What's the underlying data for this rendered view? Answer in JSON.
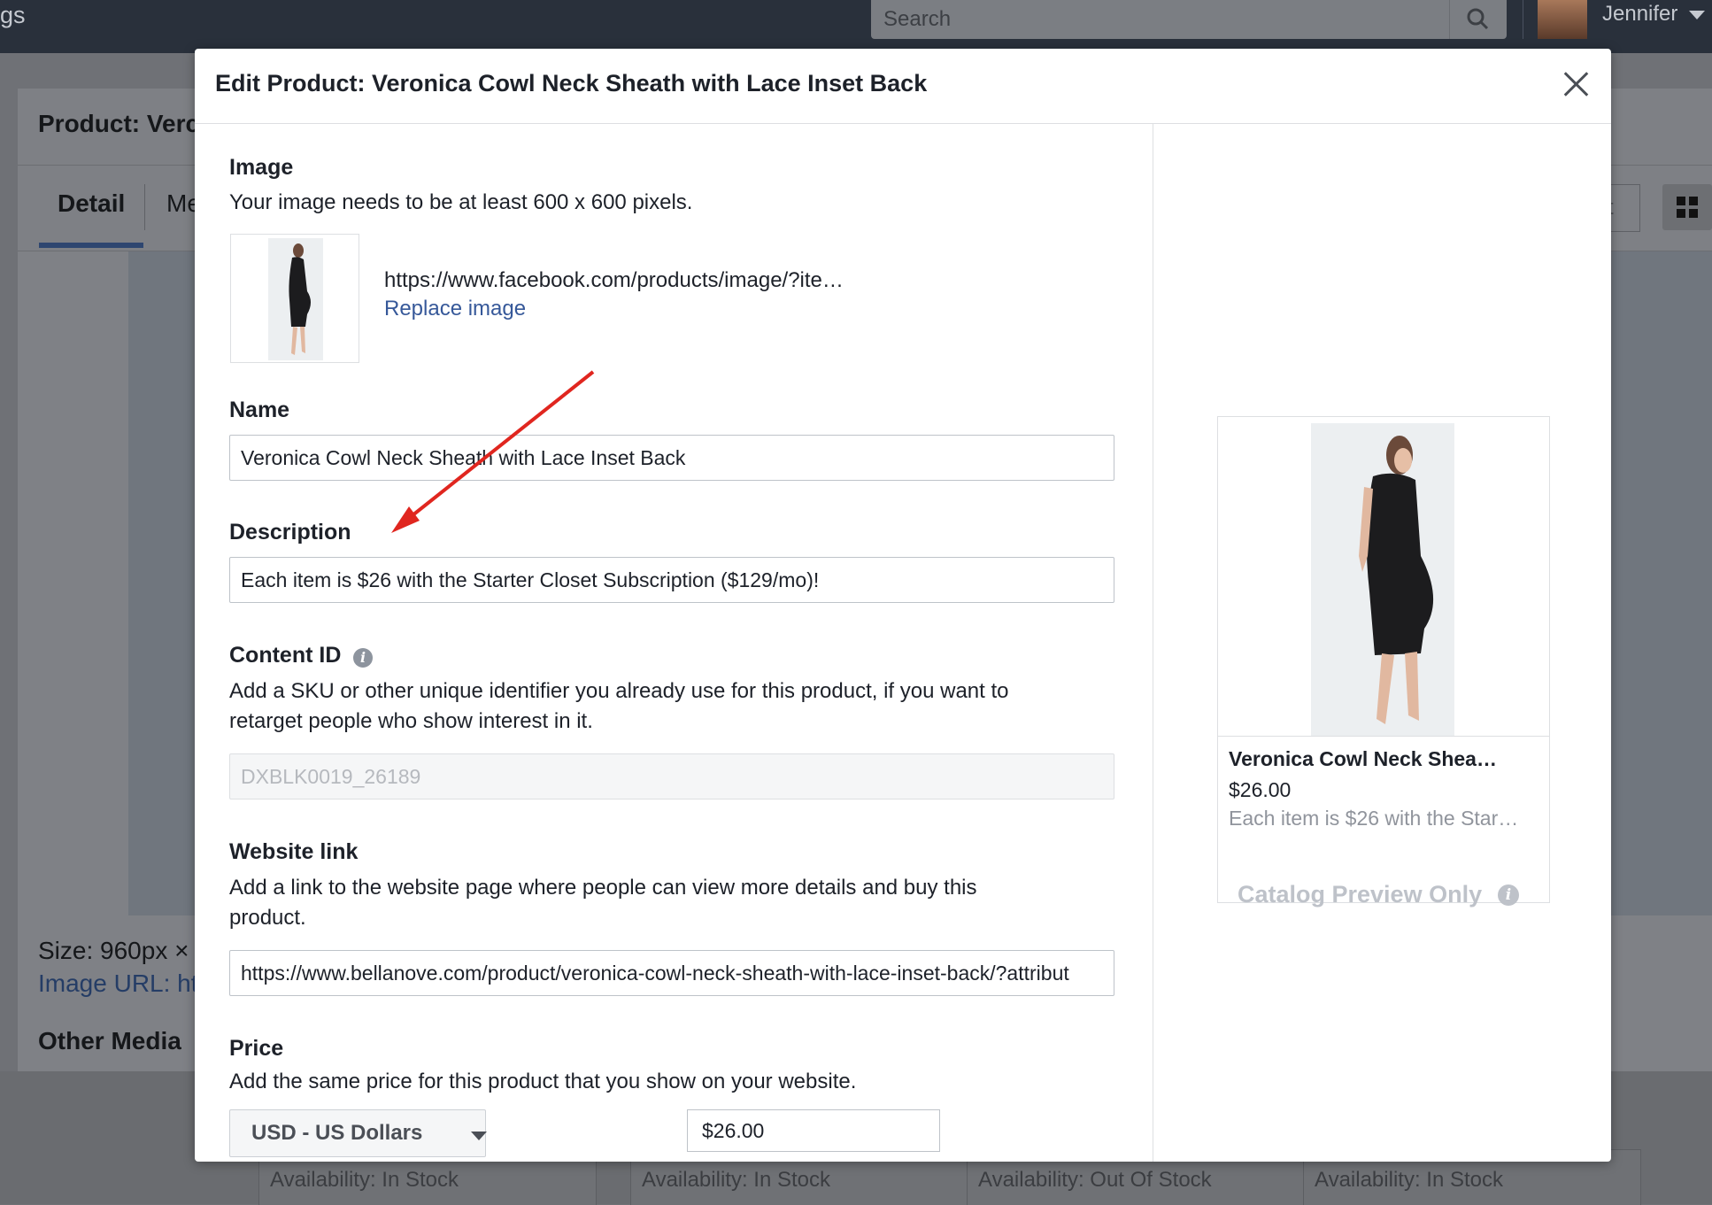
{
  "topbar": {
    "brand_fragment": "gs",
    "search_placeholder": "Search",
    "user_name": "Jennifer"
  },
  "background": {
    "product_title": "Product: Verc",
    "tabs": [
      "Detail",
      "Me"
    ],
    "size_text": "Size: 960px ×",
    "image_url_text": "Image URL: ht",
    "other_media": "Other Media",
    "right_button_fragment": "t",
    "availability": [
      "Availability: In Stock",
      "Availability: In Stock",
      "Availability: Out Of Stock",
      "Availability: In Stock"
    ]
  },
  "modal": {
    "title": "Edit Product: Veronica Cowl Neck Sheath with Lace Inset Back",
    "image": {
      "label": "Image",
      "help": "Your image needs to be at least 600 x 600 pixels.",
      "url": "https://www.facebook.com/products/image/?ite…",
      "replace_link": "Replace image"
    },
    "name": {
      "label": "Name",
      "value": "Veronica Cowl Neck Sheath with Lace Inset Back"
    },
    "description": {
      "label": "Description",
      "value": "Each item is $26 with the Starter Closet Subscription ($129/mo)!"
    },
    "content_id": {
      "label": "Content ID",
      "help_line1": "Add a SKU or other unique identifier you already use for this product, if you want to",
      "help_line2": "retarget people who show interest in it.",
      "value": "DXBLK0019_26189"
    },
    "website_link": {
      "label": "Website link",
      "help_line1": "Add a link to the website page where people can view more details and buy this",
      "help_line2": "product.",
      "value": "https://www.bellanove.com/product/veronica-cowl-neck-sheath-with-lace-inset-back/?attribut"
    },
    "price": {
      "label": "Price",
      "help": "Add the same price for this product that you show on your website.",
      "currency": "USD - US Dollars",
      "value": "$26.00"
    },
    "preview": {
      "name": "Veronica Cowl Neck Shea…",
      "price": "$26.00",
      "description": "Each item is $26 with the Star…",
      "note": "Catalog Preview Only"
    }
  },
  "colors": {
    "link": "#365899",
    "annotation_arrow": "#e0261f",
    "topbar": "#29303b"
  }
}
